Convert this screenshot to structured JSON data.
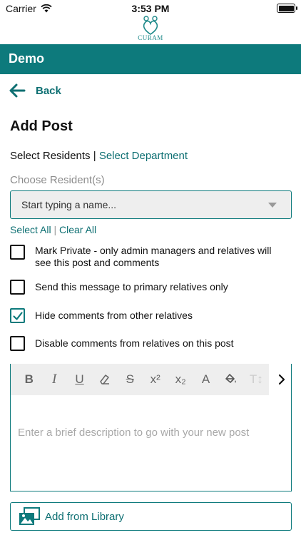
{
  "status_bar": {
    "carrier": "Carrier",
    "time": "3:53 PM"
  },
  "logo": {
    "text": "CURAM"
  },
  "header": {
    "title": "Demo"
  },
  "nav": {
    "back_label": "Back"
  },
  "page": {
    "title": "Add Post"
  },
  "selection": {
    "residents_label": "Select Residents",
    "separator": "|",
    "department_label": "Select Department",
    "choose_label": "Choose Resident(s)",
    "input_placeholder": "Start typing a name...",
    "select_all": "Select All",
    "clear_all": "Clear All",
    "links_separator": "|"
  },
  "options": [
    {
      "label": "Mark Private - only admin managers and relatives will see this post and comments",
      "checked": false
    },
    {
      "label": "Send this message to primary relatives only",
      "checked": false
    },
    {
      "label": "Hide comments from other relatives",
      "checked": true
    },
    {
      "label": "Disable comments from relatives on this post",
      "checked": false
    }
  ],
  "editor": {
    "tools": [
      "B",
      "I",
      "U",
      "clear-format",
      "S",
      "x²",
      "x₂",
      "A",
      "fill",
      "T↕"
    ],
    "placeholder": "Enter a brief description to go with your new post"
  },
  "library": {
    "label": "Add from Library"
  },
  "colors": {
    "brand": "#0d7a7c",
    "link": "#0d6f72",
    "toolbar_bg": "#eeeeee"
  }
}
